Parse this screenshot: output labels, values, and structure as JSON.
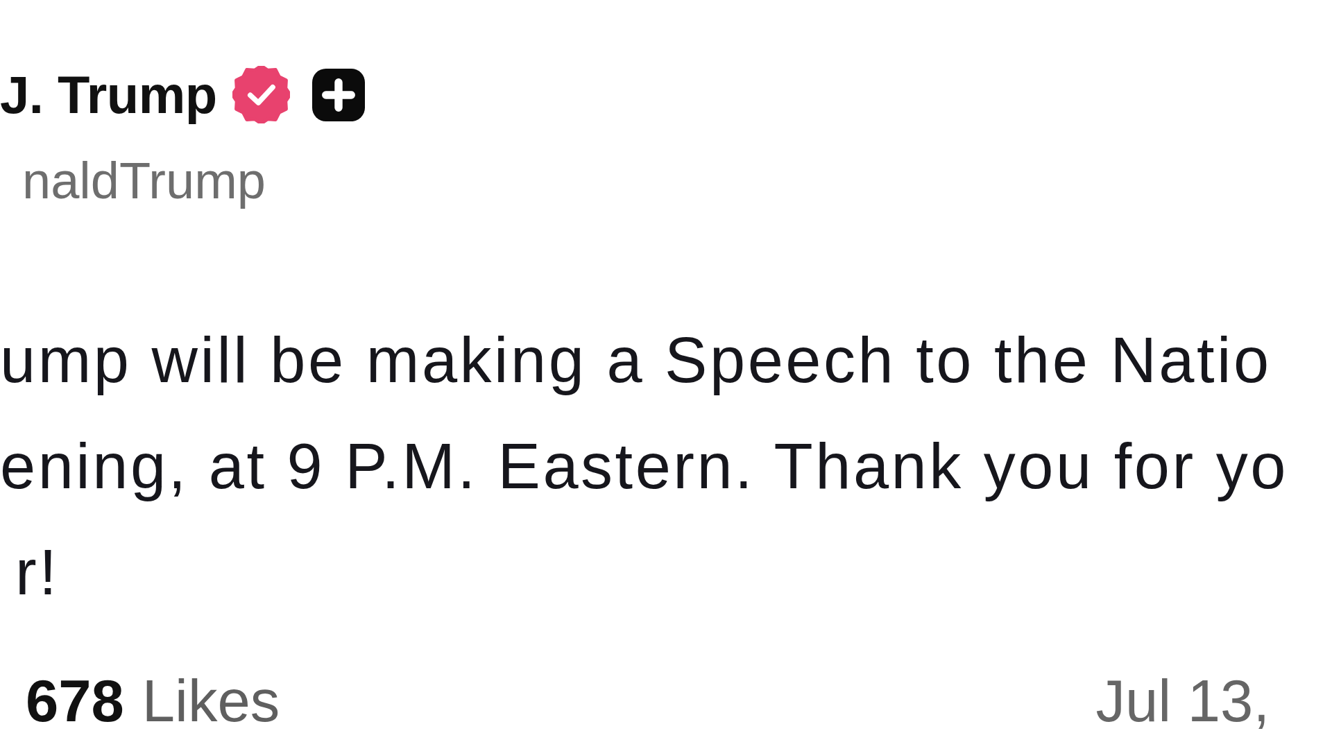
{
  "author": {
    "name": "J. Trump",
    "verified": true,
    "handle": "naldTrump"
  },
  "post": {
    "lines": [
      "ump will be making a Speech to the Natio",
      "ening, at 9 P.M. Eastern. Thank you for yo",
      "r!"
    ]
  },
  "stats": {
    "likes_count": "678",
    "likes_label": "Likes",
    "date": "Jul 13,"
  }
}
